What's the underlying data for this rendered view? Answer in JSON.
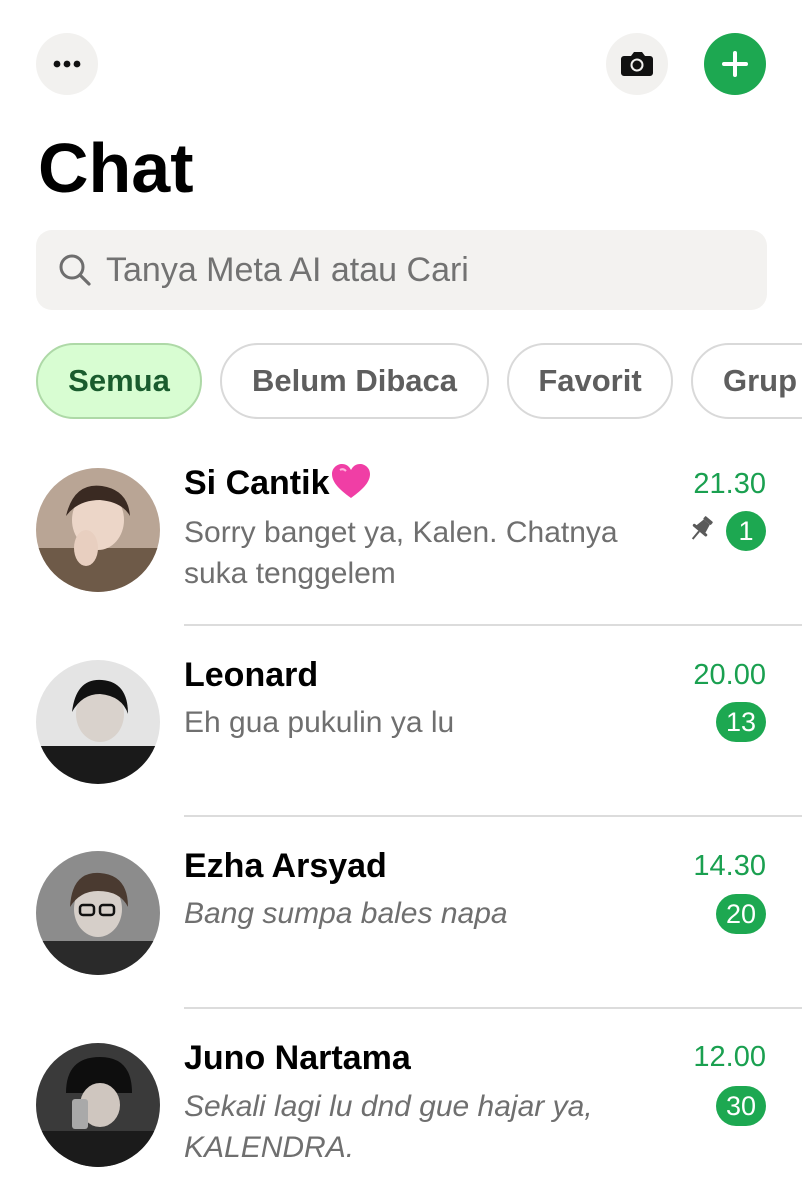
{
  "header": {
    "title": "Chat",
    "more_icon": "ellipsis-icon",
    "camera_icon": "camera-icon",
    "new_chat_icon": "plus-icon"
  },
  "search": {
    "placeholder": "Tanya Meta AI atau Cari"
  },
  "filters": [
    {
      "label": "Semua",
      "active": true
    },
    {
      "label": "Belum Dibaca",
      "active": false
    },
    {
      "label": "Favorit",
      "active": false
    },
    {
      "label": "Grup",
      "active": false
    }
  ],
  "chats": [
    {
      "name": "Si Cantik",
      "name_emoji": "heart-icon",
      "preview": "Sorry banget ya, Kalen. Chatnya suka tenggelem",
      "time": "21.30",
      "unread": "1",
      "pinned": true
    },
    {
      "name": "Leonard",
      "preview": "Eh gua pukulin ya lu",
      "time": "20.00",
      "unread": "13",
      "pinned": false
    },
    {
      "name": "Ezha Arsyad",
      "preview": "Bang sumpa bales napa",
      "time": "14.30",
      "unread": "20",
      "pinned": false
    },
    {
      "name": "Juno Nartama",
      "preview": "Sekali lagi lu dnd gue hajar ya, KALENDRA.",
      "time": "12.00",
      "unread": "30",
      "pinned": false
    }
  ],
  "colors": {
    "accent": "#1da851",
    "chip_active_bg": "#d8fdd2",
    "time_green": "#1aa050"
  }
}
